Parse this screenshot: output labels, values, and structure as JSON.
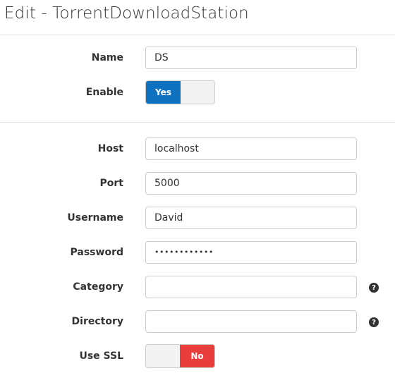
{
  "window": {
    "title": "Edit - TorrentDownloadStation"
  },
  "general": {
    "name_label": "Name",
    "name_value": "DS",
    "enable_label": "Enable",
    "enable_value": "Yes"
  },
  "connection": {
    "host_label": "Host",
    "host_value": "localhost",
    "port_label": "Port",
    "port_value": "5000",
    "username_label": "Username",
    "username_value": "David",
    "password_label": "Password",
    "password_value": "••••••••••••",
    "category_label": "Category",
    "category_value": "",
    "directory_label": "Directory",
    "directory_value": "",
    "use_ssl_label": "Use SSL",
    "use_ssl_value": "No"
  },
  "icons": {
    "help": "question-circle-icon"
  },
  "colors": {
    "toggle_yes": "#0f72c1",
    "toggle_no": "#e93c3c",
    "help_icon": "#333333"
  }
}
